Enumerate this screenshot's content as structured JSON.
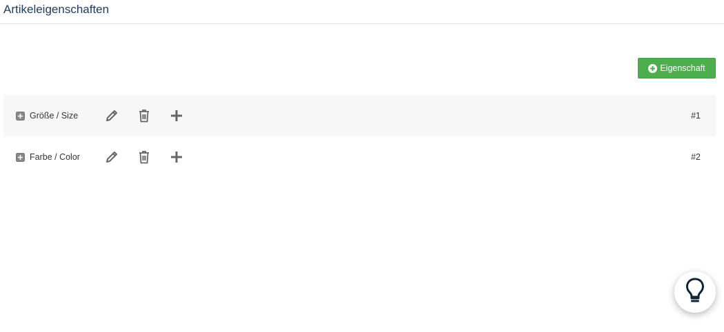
{
  "header": {
    "title": "Artikeleigenschaften"
  },
  "toolbar": {
    "add_label": "Eigenschaft",
    "add_icon": "plus-circle-icon",
    "accent": "#4cae4c"
  },
  "properties": [
    {
      "label": "Größe / Size",
      "number": "#1",
      "icons": [
        "expand-icon",
        "pencil-icon",
        "trash-icon",
        "plus-icon"
      ]
    },
    {
      "label": "Farbe / Color",
      "number": "#2",
      "icons": [
        "expand-icon",
        "pencil-icon",
        "trash-icon",
        "plus-icon"
      ]
    }
  ],
  "help": {
    "icon": "lightbulb-icon"
  }
}
